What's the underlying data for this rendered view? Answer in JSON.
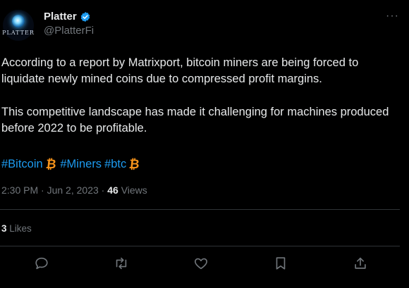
{
  "author": {
    "name": "Platter",
    "handle": "@PlatterFi",
    "avatar_text": "PLATTER",
    "verified": true
  },
  "post": {
    "paragraph1": "According to a report by Matrixport, bitcoin miners are being forced to liquidate newly mined coins due to compressed profit margins.",
    "paragraph2": "This competitive landscape has made it challenging for machines produced before 2022 to be profitable.",
    "hashtags": [
      "#Bitcoin",
      "#Miners",
      "#btc"
    ],
    "emoji_symbol": "₿"
  },
  "meta": {
    "time": "2:30 PM",
    "separator": "·",
    "date": "Jun 2, 2023",
    "views_count": "46",
    "views_label": "Views"
  },
  "engagement": {
    "likes_count": "3",
    "likes_label": "Likes"
  },
  "more_icon": "···",
  "colors": {
    "background": "#000000",
    "text": "#e7e9ea",
    "muted": "#71767b",
    "link": "#1d9bf0",
    "bitcoin": "#f7931a",
    "divider": "#2f3336"
  }
}
